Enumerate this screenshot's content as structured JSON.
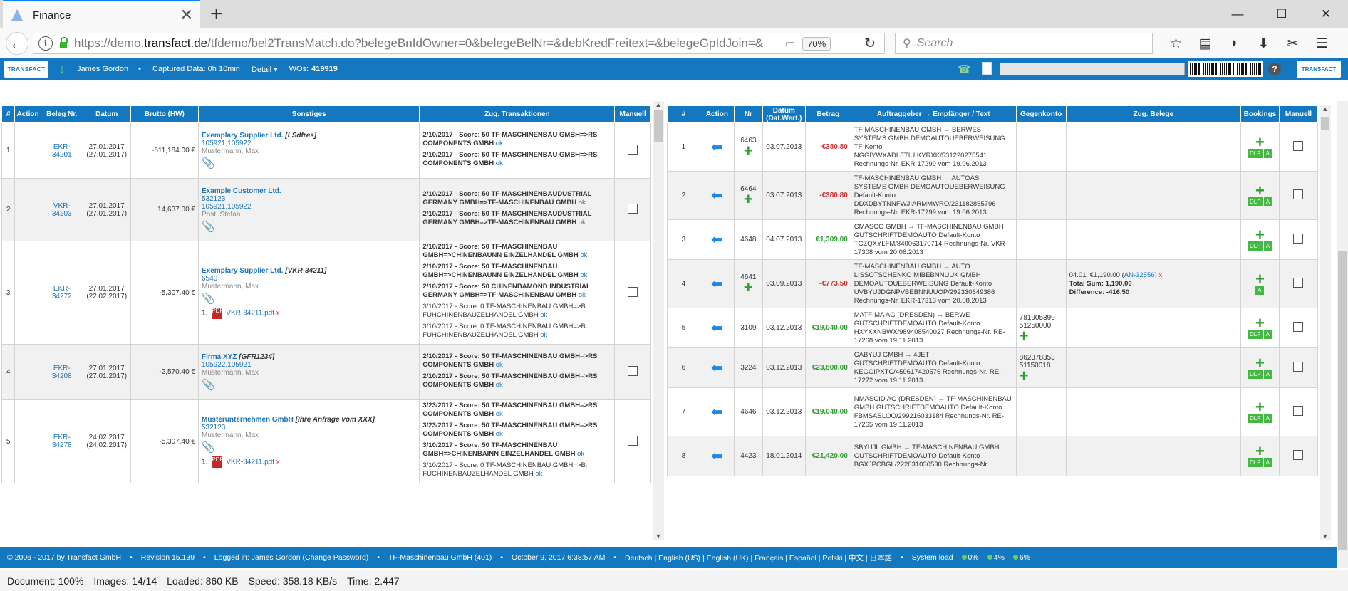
{
  "browser": {
    "tab_title": "Finance",
    "url_prefix": "https://demo.",
    "url_host": "transfact.de",
    "url_rest": "/tfdemo/bel2TransMatch.do?belegeBnIdOwner=0&belegeBelNr=&debKredFreitext=&belegeGpIdJoin=&",
    "zoom": "70%",
    "search_placeholder": "Search"
  },
  "appbar": {
    "user": "James Gordon",
    "captured": "Captured Data: 0h 10min",
    "detail": "Detail ▾",
    "wos_label": "WOs:",
    "wos_value": "419919",
    "logo": "TRANSFACT"
  },
  "left": {
    "headers": [
      "#",
      "Action",
      "Beleg Nr.",
      "Datum",
      "Brutto (HW)",
      "Sonstiges",
      "Zug. Transaktionen",
      "Manuell"
    ],
    "rows": [
      {
        "n": "1",
        "beleg": "EKR-34201",
        "d1": "27.01.2017",
        "d2": "(27.01.2017)",
        "amount": "-611,184.00 €",
        "name": "Exemplary Supplier Ltd.",
        "ref": "[LSdfres]",
        "ids": "105921,105922",
        "person": "Mustermann, Max",
        "tx": [
          {
            "t": "2/10/2017 - Score: 50  TF-MASCHINENBAU GMBH=>RS COMPONENTS GMBH",
            "ok": "ok"
          },
          {
            "t": "2/10/2017 - Score: 50  TF-MASCHINENBAU GMBH=>RS COMPONENTS GMBH",
            "ok": "ok"
          }
        ]
      },
      {
        "n": "2",
        "beleg": "VKR-34203",
        "d1": "27.01.2017",
        "d2": "(27.01.2017)",
        "amount": "14,637.00 €",
        "name": "Example Customer Ltd.",
        "ref": "",
        "ids": "532123",
        "ids2": "105921,105922",
        "person": "Post, Stefan",
        "tx": [
          {
            "t": "2/10/2017 - Score: 50  TF-MASCHINENBAUDUSTRIAL GERMANY GMBH=>TF-MASCHINENBAU GMBH",
            "ok": "ok"
          },
          {
            "t": "2/10/2017 - Score: 50  TF-MASCHINENBAUDUSTRIAL GERMANY GMBH=>TF-MASCHINENBAU GMBH",
            "ok": "ok"
          }
        ]
      },
      {
        "n": "3",
        "beleg": "EKR-34272",
        "d1": "27.01.2017",
        "d2": "(22.02.2017)",
        "amount": "-5,307.40 €",
        "name": "Exemplary Supplier Ltd.",
        "ref": "[VKR-34211]",
        "ids": "6540",
        "person": "Mustermann, Max",
        "pdf": "VKR-34211.pdf",
        "pdfn": "1.",
        "tx": [
          {
            "t": "2/10/2017 - Score: 50  TF-MASCHINENBAU GMBH=>CHINENBAUNN EINZELHANDEL GMBH",
            "ok": "ok"
          },
          {
            "t": "2/10/2017 - Score: 50  TF-MASCHINENBAU GMBH=>CHINENBAUNN EINZELHANDEL GMBH",
            "ok": "ok"
          },
          {
            "t": "2/10/2017 - Score: 50  CHINENBAMOND INDUSTRIAL GERMANY GMBH=>TF-MASCHINENBAU GMBH",
            "ok": "ok"
          },
          {
            "t": "3/10/2017 - Score: 0  TF-MASCHINENBAU GMBH=>B. FUHCHINENBAUZELHANDEL GMBH",
            "ok": "ok",
            "nb": true
          },
          {
            "t": "3/10/2017 - Score: 0  TF-MASCHINENBAU GMBH=>B. FUHCHINENBAUZELHANDEL GMBH",
            "ok": "ok",
            "nb": true
          }
        ]
      },
      {
        "n": "4",
        "beleg": "EKR-34208",
        "d1": "27.01.2017",
        "d2": "(27.01.2017)",
        "amount": "-2,570.40 €",
        "name": "Firma XYZ",
        "ref": "[GFR1234]",
        "ids": "105922,105921",
        "person": "Mustermann, Max",
        "tx": [
          {
            "t": "2/10/2017 - Score: 50  TF-MASCHINENBAU GMBH=>RS COMPONENTS GMBH",
            "ok": "ok"
          },
          {
            "t": "2/10/2017 - Score: 50  TF-MASCHINENBAU GMBH=>RS COMPONENTS GMBH",
            "ok": "ok"
          }
        ]
      },
      {
        "n": "5",
        "beleg": "EKR-34278",
        "d1": "24.02.2017",
        "d2": "(24.02.2017)",
        "amount": "-5,307.40 €",
        "name": "Musterunternehmen GmbH",
        "ref": "[Ihre Anfrage vom XXX]",
        "ids": "532123",
        "person": "Mustermann, Max",
        "pdf": "VKR-34211.pdf",
        "pdfn": "1.",
        "tx": [
          {
            "t": "3/23/2017 - Score: 50  TF-MASCHINENBAU GMBH=>RS COMPONENTS GMBH",
            "ok": "ok"
          },
          {
            "t": "3/23/2017 - Score: 50  TF-MASCHINENBAU GMBH=>RS COMPONENTS GMBH",
            "ok": "ok"
          },
          {
            "t": "3/10/2017 - Score: 50  TF-MASCHINENBAU GMBH=>CHINENBAINN EINZELHANDEL GMBH",
            "ok": "ok"
          },
          {
            "t": "3/10/2017 - Score: 0  TF-MASCHINENBAU GMBH=>B. FUCHINENBAUZELHANDEL GMBH",
            "ok": "ok",
            "nb": true
          }
        ]
      }
    ]
  },
  "right": {
    "headers": [
      "#",
      "Action",
      "Nr",
      "Datum (Dat.Wert.)",
      "Betrag",
      "Auftraggeber → Empfänger / Text",
      "Gegenkonto",
      "Zug. Belege",
      "Bookings",
      "Manuell"
    ],
    "rows": [
      {
        "n": "1",
        "nr": "6463",
        "plus": true,
        "date": "03.07.2013",
        "amount": "-€380.80",
        "neg": true,
        "text": "TF-MASCHINENBAU GMBH → BERWES SYSTEMS GMBH DEMOAUTOUEBERWEISUNG TF-Konto NGGIYWXADLFTIUIKYRXK/531220275541 Rechnungs-Nr. EKR-17299 vom 19.06.2013",
        "gk": "",
        "gkplus": false,
        "belege": "",
        "a_only": false
      },
      {
        "n": "2",
        "nr": "6464",
        "plus": true,
        "date": "03.07.2013",
        "amount": "-€380.80",
        "neg": true,
        "text": "TF-MASCHINENBAU GMBH → AUTOAS SYSTEMS GMBH DEMOAUTOUEBERWEISUNG Default-Konto DDXDBYTNNFWJIARMMWRO/231182865796 Rechnungs-Nr. EKR-17299 vom 19.06.2013",
        "gk": "",
        "gkplus": false,
        "belege": "",
        "a_only": false
      },
      {
        "n": "3",
        "nr": "4648",
        "plus": false,
        "date": "04.07.2013",
        "amount": "€1,309.00",
        "neg": false,
        "text": "CMASCO GMBH → TF-MASCHINENBAU GMBH GUTSCHRIFTDEMOAUTO Default-Konto TCZQXYLFM/840063170714 Rechnungs-Nr. VKR-17308 vom 20.06.2013",
        "gk": "",
        "gkplus": false,
        "belege": "",
        "a_only": false
      },
      {
        "n": "4",
        "nr": "4641",
        "plus": true,
        "date": "03.09.2013",
        "amount": "-€773.50",
        "neg": true,
        "text": "TF-MASCHINENBAU GMBH → AUTO LISSOTSCHENKO MIBEBNNUUK GMBH DEMOAUTOUEBERWEISUNG Default-Konto UVBYUJDGNPVBEBNNUUOP/292330649386 Rechnungs-Nr. EKR-17313 vom 20.08.2013",
        "gk": "",
        "gkplus": false,
        "belege": "04.01. €1,190.00",
        "belege_link": "AN-32556",
        "total": "Total Sum:  1,190.00",
        "diff": "Difference:  -416.50",
        "a_only": true
      },
      {
        "n": "5",
        "nr": "3109",
        "plus": false,
        "date": "03.12.2013",
        "amount": "€19,040.00",
        "neg": false,
        "text": "MATF-MA AG (DRESDEN) → BERWE GUTSCHRIFTDEMOAUTO Default-Konto HXYXXNBWX/989408540027 Rechnungs-Nr. RE-17268 vom 19.11.2013",
        "gk": "781905399",
        "gk2": "51250000",
        "gkplus": true,
        "belege": "",
        "a_only": false
      },
      {
        "n": "6",
        "nr": "3224",
        "plus": false,
        "date": "03.12.2013",
        "amount": "€23,800.00",
        "neg": false,
        "text": "CABYUJ GMBH → 4JET GUTSCHRIFTDEMOAUTO Default-Konto KEGGIPXTC/459617420576 Rechnungs-Nr. RE-17272 vom 19.11.2013",
        "gk": "862378353",
        "gk2": "51150018",
        "gkplus": true,
        "belege": "",
        "a_only": false
      },
      {
        "n": "7",
        "nr": "4646",
        "plus": false,
        "date": "03.12.2013",
        "amount": "€19,040.00",
        "neg": false,
        "text": "NMASCID AG (DRESDEN) → TF-MASCHINENBAU GMBH GUTSCHRIFTDEMOAUTO Default-Konto FBMSASLOO/299216033184 Rechnungs-Nr. RE-17265 vom 19.11.2013",
        "gk": "",
        "gkplus": false,
        "belege": "",
        "a_only": false
      },
      {
        "n": "8",
        "nr": "4423",
        "plus": false,
        "date": "18.01.2014",
        "amount": "€21,420.00",
        "neg": false,
        "text": "SBYUJL GMBH → TF-MASCHINENBAU GMBH GUTSCHRIFTDEMOAUTO Default-Konto BGXJPCBGL/222631030530 Rechnungs-Nr.",
        "gk": "",
        "gkplus": false,
        "belege": "",
        "a_only": false
      }
    ],
    "dlp": "DLP",
    "a": "A"
  },
  "footer": {
    "copyright": "© 2006 - 2017 by Transfact GmbH",
    "revision": "Revision  15.139",
    "logged": "Logged in: James Gordon (Change Password)",
    "company": "TF-Maschinenbau GmbH (401)",
    "date": "October 9, 2017 6:38:57 AM",
    "langs": "Deutsch | English (US) | English (UK) | Français | Español | Polski | 中文 | 日本語",
    "sysload": "System load",
    "l1": "0%",
    "l2": "4%",
    "l3": "6%"
  },
  "status": {
    "document": "Document: 100%",
    "images": "Images: 14/14",
    "loaded": "Loaded: 860 KB",
    "speed": "Speed: 358.18 KB/s",
    "time": "Time: 2.447"
  }
}
